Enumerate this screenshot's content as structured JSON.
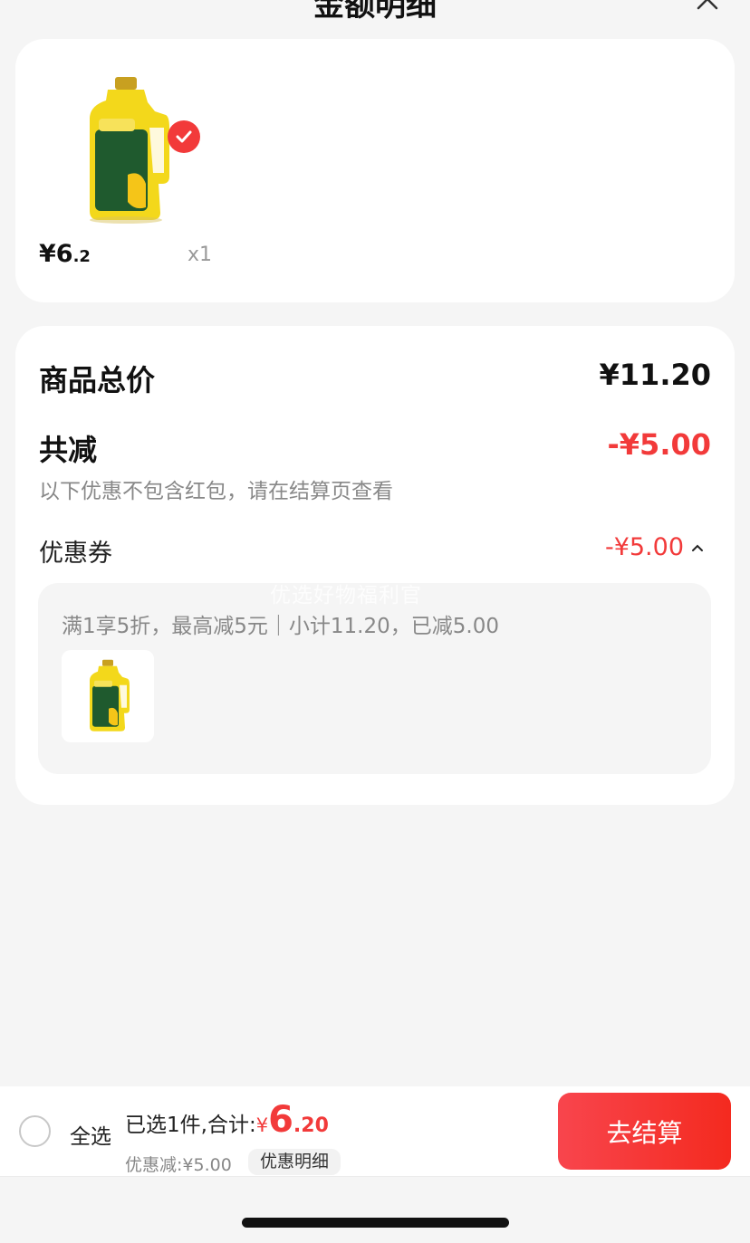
{
  "header": {
    "title": "金额明细"
  },
  "product": {
    "price_int": "¥6",
    "price_dec": ".2",
    "qty": "x1"
  },
  "summary": {
    "total_label": "商品总价",
    "total_value": "¥11.20",
    "reduce_label": "共减",
    "reduce_value": "-¥5.00",
    "note": "以下优惠不包含红包，请在结算页查看",
    "coupon_label": "优惠券",
    "coupon_value": "-¥5.00",
    "coupon_desc": "满1享5折，最高减5元｜小计11.20，已减5.00",
    "watermark": "优选好物福利官"
  },
  "bottom": {
    "select_all": "全选",
    "selected_text": "已选1件,合计:",
    "currency": "¥",
    "total_int": "6",
    "total_dec": ".20",
    "discount_text": "优惠减:¥5.00",
    "detail_button": "优惠明细",
    "checkout_button": "去结算"
  },
  "colors": {
    "accent": "#f23a3a",
    "background": "#f5f5f5",
    "card": "#ffffff"
  },
  "icons": {
    "close": "close-icon",
    "check": "check-badge-icon",
    "chevron": "chevron-up-icon"
  }
}
